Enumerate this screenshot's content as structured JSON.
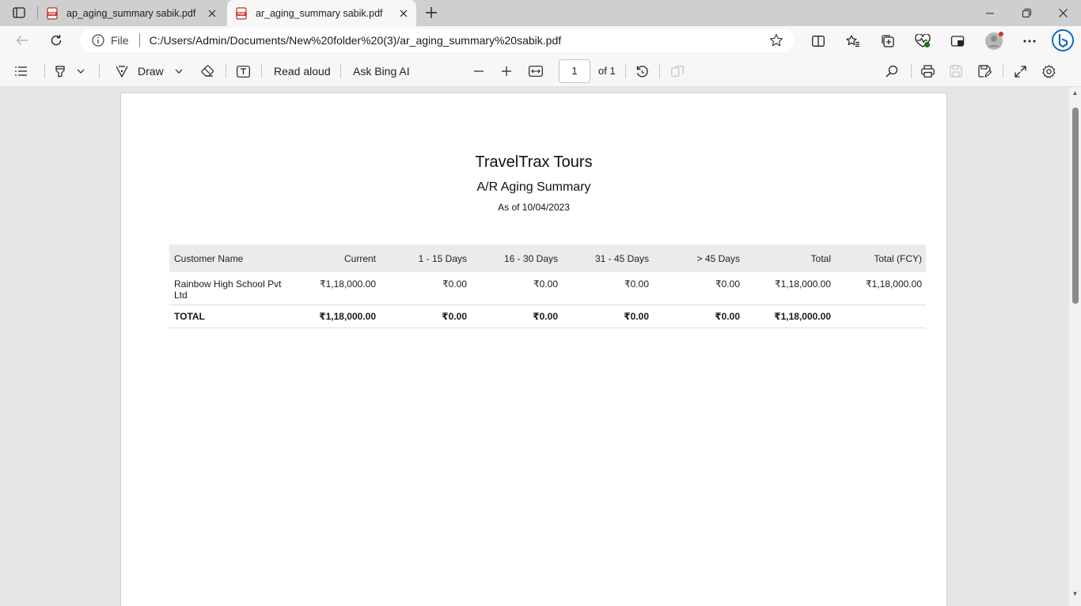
{
  "browser": {
    "tabs": [
      {
        "title": "ap_aging_summary sabik.pdf",
        "active": false
      },
      {
        "title": "ar_aging_summary sabik.pdf",
        "active": true
      }
    ],
    "address": {
      "scheme_label": "File",
      "url": "C:/Users/Admin/Documents/New%20folder%20(3)/ar_aging_summary%20sabik.pdf"
    }
  },
  "pdf_toolbar": {
    "draw_label": "Draw",
    "read_aloud_label": "Read aloud",
    "ask_bing_label": "Ask Bing AI",
    "page_number": "1",
    "page_of": "of 1"
  },
  "report": {
    "company": "TravelTrax Tours",
    "title": "A/R Aging Summary",
    "as_of": "As of 10/04/2023",
    "columns": [
      "Customer Name",
      "Current",
      "1 - 15 Days",
      "16 - 30 Days",
      "31 - 45 Days",
      "> 45 Days",
      "Total",
      "Total (FCY)"
    ],
    "rows": [
      {
        "customer": "Rainbow High School Pvt Ltd",
        "current": "₹1,18,000.00",
        "d1_15": "₹0.00",
        "d16_30": "₹0.00",
        "d31_45": "₹0.00",
        "d45_plus": "₹0.00",
        "total": "₹1,18,000.00",
        "total_fcy": "₹1,18,000.00"
      }
    ],
    "total_row": {
      "label": "TOTAL",
      "current": "₹1,18,000.00",
      "d1_15": "₹0.00",
      "d16_30": "₹0.00",
      "d31_45": "₹0.00",
      "d45_plus": "₹0.00",
      "total": "₹1,18,000.00",
      "total_fcy": ""
    }
  },
  "colors": {
    "pdf_icon_red": "#c42b1c",
    "accent_blue": "#0f6cbd",
    "notification_red": "#d13438"
  }
}
